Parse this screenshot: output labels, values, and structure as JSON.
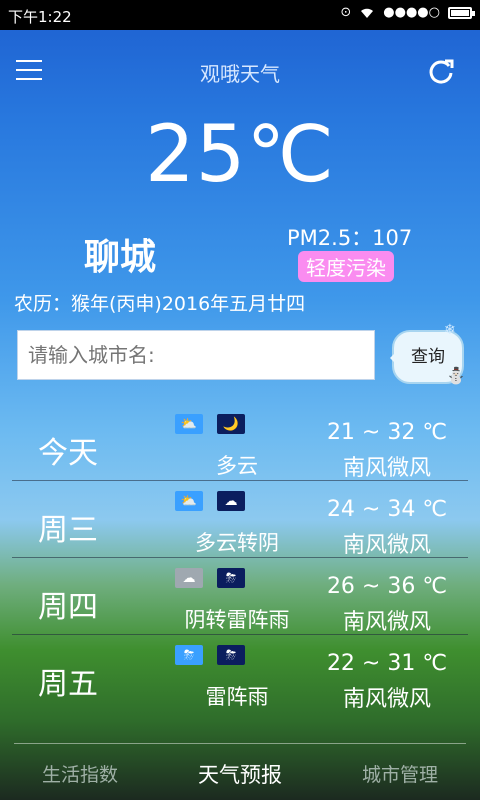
{
  "status_bar": {
    "time": "下午1:22",
    "signal": "●●●●○",
    "battery_level": 0.8
  },
  "header": {
    "title": "观哦天气",
    "menu_icon": "menu-icon",
    "refresh_icon": "refresh-icon"
  },
  "current": {
    "temperature": "25℃",
    "city": "聊城",
    "pm25": "PM2.5：107",
    "pollution_label": "轻度污染",
    "pollution_color": "#fa8cf0",
    "lunar": "农历：猴年(丙申)2016年五月廿四"
  },
  "search": {
    "placeholder": "请输入城市名:",
    "button_label": "查询"
  },
  "forecast": [
    {
      "day": "今天",
      "day_icon": "partly-cloudy-sun-icon",
      "night_icon": "moon-cloud-icon",
      "condition": "多云",
      "range": "21 ~ 32 ℃",
      "wind": "南风微风"
    },
    {
      "day": "周三",
      "day_icon": "partly-cloudy-sun-icon",
      "night_icon": "cloud-icon",
      "condition": "多云转阴",
      "range": "24 ~ 34 ℃",
      "wind": "南风微风"
    },
    {
      "day": "周四",
      "day_icon": "overcast-icon",
      "night_icon": "thunderstorm-icon",
      "condition": "阴转雷阵雨",
      "range": "26 ~ 36 ℃",
      "wind": "南风微风"
    },
    {
      "day": "周五",
      "day_icon": "thunderstorm-icon",
      "night_icon": "thunderstorm-icon",
      "condition": "雷阵雨",
      "range": "22 ~ 31 ℃",
      "wind": "南风微风"
    }
  ],
  "bottom_nav": [
    {
      "label": "生活指数",
      "active": false
    },
    {
      "label": "天气预报",
      "active": true
    },
    {
      "label": "城市管理",
      "active": false
    }
  ]
}
